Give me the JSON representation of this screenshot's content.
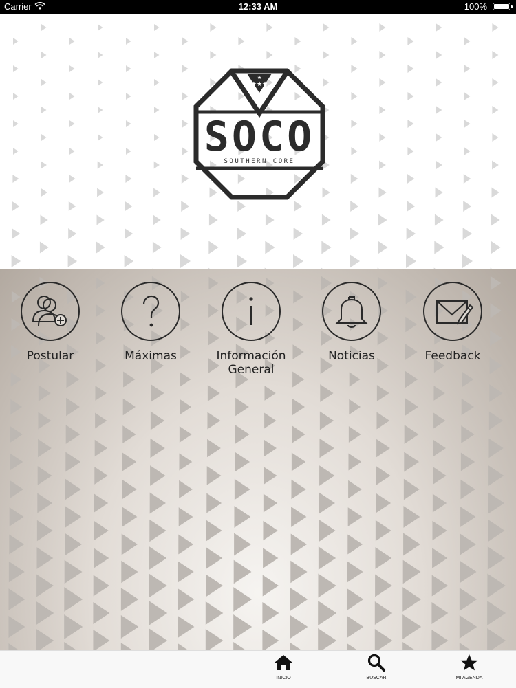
{
  "status_bar": {
    "carrier": "Carrier",
    "time": "12:33 AM",
    "battery": "100%"
  },
  "logo": {
    "text": "SOCO",
    "subtitle": "SOUTHERN CORE"
  },
  "menu": [
    {
      "label": "Postular",
      "icon": "user-add-icon"
    },
    {
      "label": "Máximas",
      "icon": "question-icon"
    },
    {
      "label": "Información General",
      "icon": "info-icon"
    },
    {
      "label": "Noticias",
      "icon": "bell-icon"
    },
    {
      "label": "Feedback",
      "icon": "envelope-pencil-icon"
    }
  ],
  "tabbar": {
    "items": [
      {
        "label": "INICIO",
        "icon": "home-icon"
      },
      {
        "label": "BUSCAR",
        "icon": "search-icon"
      },
      {
        "label": "MI AGENDA",
        "icon": "star-icon"
      }
    ]
  },
  "colors": {
    "icon_stroke": "#2a2a2a",
    "pattern_top": "#d9d9d9",
    "pattern_bottom": "#bdb8b3",
    "tab_icon": "#111111"
  }
}
